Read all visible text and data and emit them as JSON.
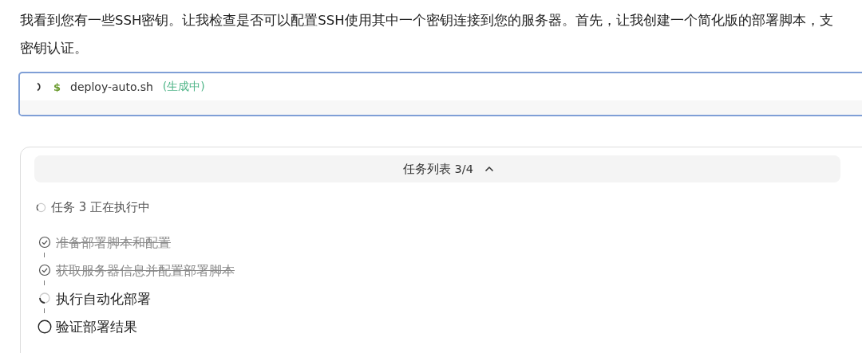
{
  "message": {
    "text": "我看到您有一些SSH密钥。让我检查是否可以配置SSH使用其中一个密钥连接到您的服务器。首先，让我创建一个简化版的部署脚本，支密钥认证。"
  },
  "file_block": {
    "prompt": "$",
    "filename": "deploy-auto.sh",
    "status": "(生成中)",
    "loading": true
  },
  "task_list": {
    "title": "任务列表 3/4",
    "expanded": true,
    "current": "任务 3 正在执行中",
    "tasks": [
      {
        "label": "准备部署脚本和配置",
        "kind": "done"
      },
      {
        "label": "获取服务器信息并配置部署脚本",
        "kind": "done"
      },
      {
        "label": "执行自动化部署",
        "kind": "running"
      },
      {
        "label": "验证部署结果",
        "kind": "pending"
      }
    ]
  }
}
